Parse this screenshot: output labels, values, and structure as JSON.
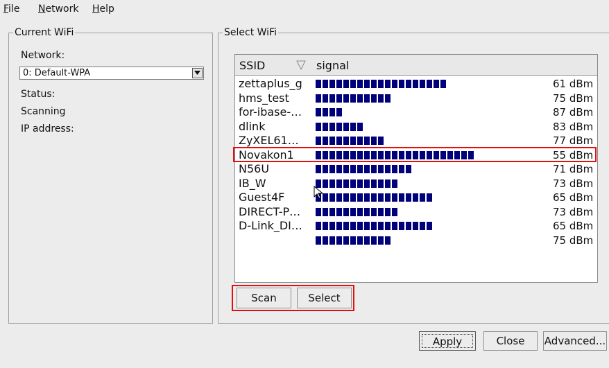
{
  "menu": [
    {
      "mnemonic": "F",
      "rest": "ile"
    },
    {
      "mnemonic": "N",
      "rest": "etwork"
    },
    {
      "mnemonic": "H",
      "rest": "elp"
    }
  ],
  "current_wifi": {
    "legend": "Current WiFi",
    "network_label": "Network:",
    "network_selected": "0: Default-WPA",
    "status_label": "Status:",
    "status_value": "Scanning",
    "ip_label": "IP address:"
  },
  "select_wifi": {
    "legend": "Select WiFi",
    "columns": [
      "SSID",
      "signal"
    ],
    "networks": [
      {
        "ssid": "zettaplus_g",
        "level": 19,
        "dbm": "61 dBm"
      },
      {
        "ssid": "hms_test",
        "level": 11,
        "dbm": "75 dBm"
      },
      {
        "ssid": "for-ibase-…",
        "level": 4,
        "dbm": "87 dBm"
      },
      {
        "ssid": "dlink",
        "level": 7,
        "dbm": "83 dBm"
      },
      {
        "ssid": "ZyXEL61…",
        "level": 10,
        "dbm": "77 dBm"
      },
      {
        "ssid": "Novakon1",
        "level": 23,
        "dbm": "55 dBm"
      },
      {
        "ssid": "N56U",
        "level": 14,
        "dbm": "71 dBm"
      },
      {
        "ssid": "IB_W",
        "level": 12,
        "dbm": "73 dBm"
      },
      {
        "ssid": "Guest4F",
        "level": 17,
        "dbm": "65 dBm"
      },
      {
        "ssid": "DIRECT-P…",
        "level": 12,
        "dbm": "73 dBm"
      },
      {
        "ssid": "D-Link_DI…",
        "level": 17,
        "dbm": "65 dBm"
      },
      {
        "ssid": "",
        "level": 11,
        "dbm": "75 dBm"
      }
    ],
    "scan_label": "Scan",
    "select_label": "Select"
  },
  "footer": {
    "apply_label": "Apply",
    "close_label": "Close",
    "advanced_label": "Advanced..."
  },
  "colors": {
    "bar": "#00007a",
    "highlight": "#e01010"
  }
}
